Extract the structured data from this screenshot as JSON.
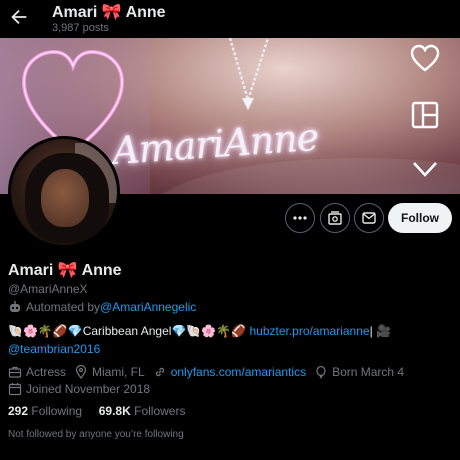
{
  "header": {
    "title": "Amari 🎀 Anne",
    "posts_count": "3,987 posts"
  },
  "banner": {
    "text": "AmariAnne"
  },
  "profile": {
    "display_name": "Amari 🎀 Anne",
    "handle": "@AmariAnneX",
    "automated_prefix": "Automated by ",
    "automated_by": "@AmariAnnegelic",
    "bio_line1_text": "🐚🌸🌴🏈💎Caribbean Angel💎🐚🌸🌴🏈 ",
    "bio_link": "hubzter.pro/amarianne",
    "bio_line1_suffix": "| 🎥",
    "bio_mention": "@teambrian2016",
    "category": "Actress",
    "location": "Miami, FL",
    "website": "onlyfans.com/amariantics",
    "birthday": "Born March 4",
    "joined": "Joined November 2018",
    "following_count": "292",
    "following_label": "Following",
    "followers_count": "69.8K",
    "followers_label": "Followers",
    "followed_by_note": "Not followed by anyone you’re following"
  },
  "actions": {
    "follow_label": "Follow"
  },
  "icons": {
    "back": "arrow-left-icon",
    "heart": "heart-icon",
    "layout": "layout-icon",
    "chevron": "chevron-down-icon",
    "more": "more-icon",
    "subscriptions": "subscriptions-icon",
    "message": "message-icon",
    "robot": "robot-icon",
    "briefcase": "briefcase-icon",
    "location": "location-pin-icon",
    "link": "link-icon",
    "balloon": "balloon-icon",
    "calendar": "calendar-icon"
  },
  "colors": {
    "background": "#000000",
    "link": "#1d9bf0",
    "muted": "#71767b",
    "text": "#e7e9ea",
    "follow_button_bg": "#eff3f4"
  }
}
